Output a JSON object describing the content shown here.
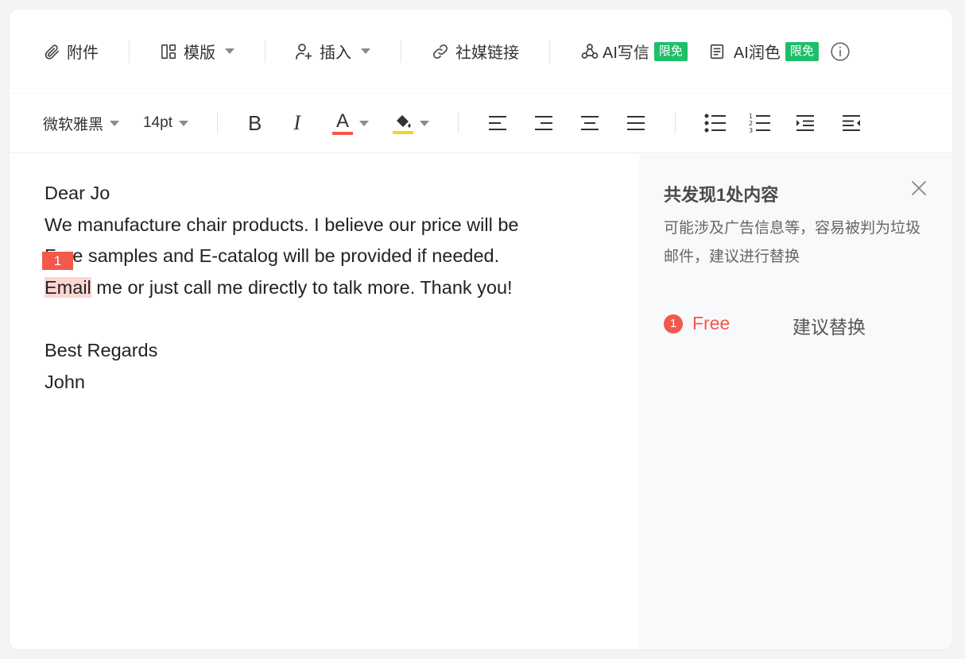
{
  "toolbar": {
    "attach_label": "附件",
    "template_label": "模版",
    "insert_label": "插入",
    "social_label": "社媒链接",
    "ai_write_label": "AI写信",
    "ai_write_badge": "限免",
    "ai_polish_label": "AI润色",
    "ai_polish_badge": "限免",
    "badge_color": "#1fbf6a"
  },
  "format": {
    "font_family": "微软雅黑",
    "font_size": "14pt",
    "bold": "B",
    "italic": "I",
    "text_color_glyph": "A",
    "text_color": "#f2594b",
    "highlight_color": "#f5d327"
  },
  "email": {
    "lines": [
      "Dear Jo",
      "We manufacture chair products. I believe our price will be",
      "Free samples and E-catalog will be provided if needed.",
      "Email me or just call me directly to talk more. Thank you!",
      "",
      "Best Regards",
      "John"
    ],
    "line4_highlight": "Email",
    "line4_rest": " me or just call me directly to talk more. Thank you!",
    "marker": "1"
  },
  "panel": {
    "title": "共发现1处内容",
    "description": "可能涉及广告信息等，容易被判为垃圾邮件，建议进行替换",
    "issues": [
      {
        "num": "1",
        "word": "Free",
        "action": "建议替换"
      }
    ],
    "accent_color": "#f2594b"
  }
}
